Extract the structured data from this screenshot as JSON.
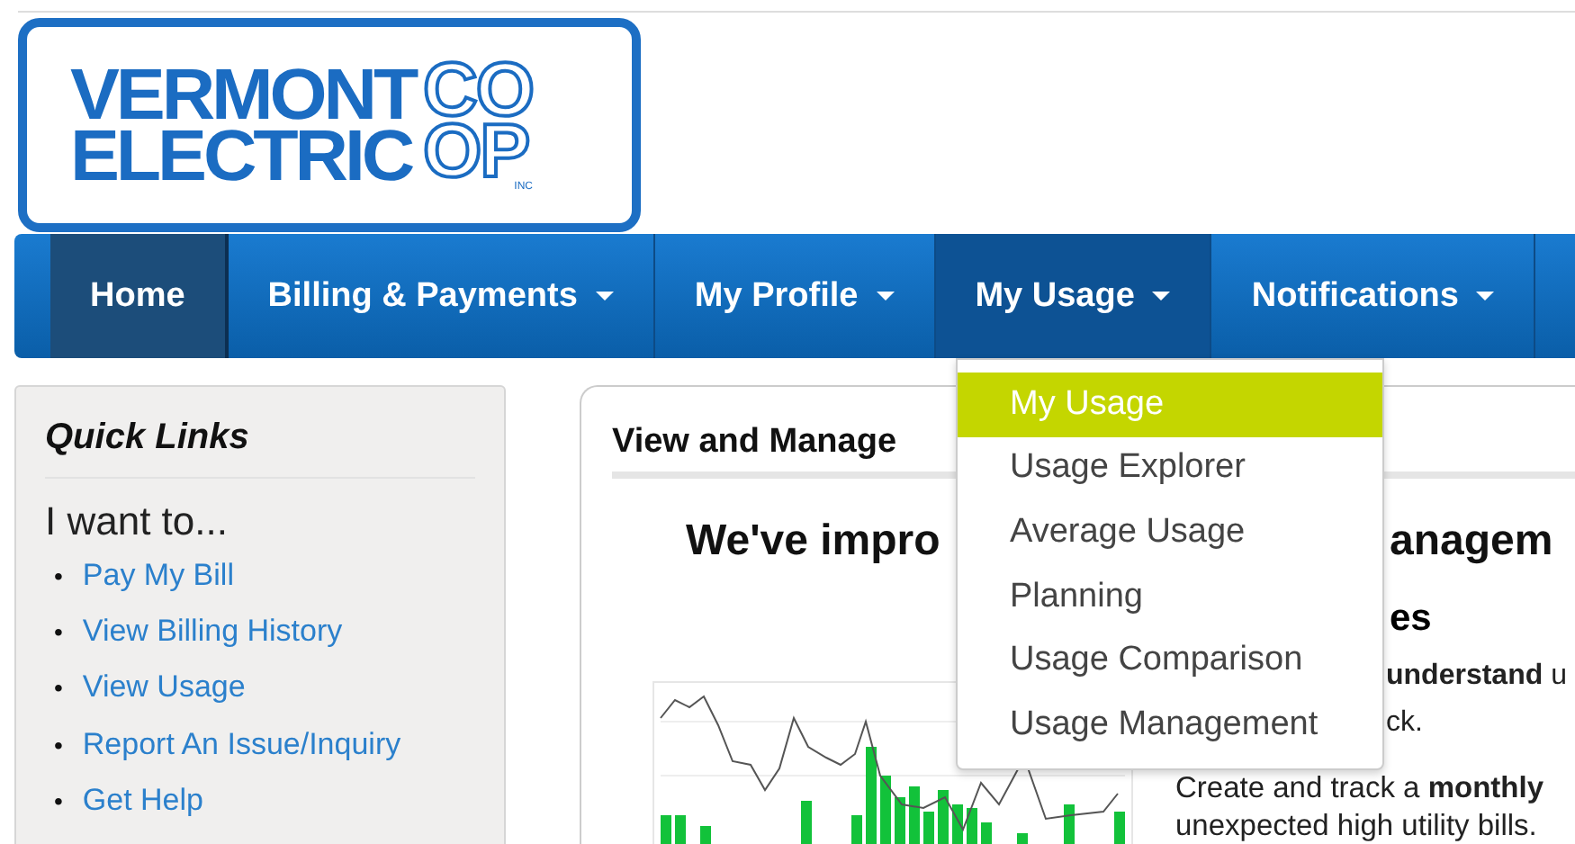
{
  "logo": {
    "line_1": "VERMONT",
    "line_2": "ELECTRIC",
    "mark_1": "CO",
    "mark_2": "OP",
    "mark_suffix": "INC"
  },
  "nav": [
    {
      "label": "Home",
      "selected": true,
      "has_menu": false,
      "open": false
    },
    {
      "label": "Billing & Payments",
      "selected": false,
      "has_menu": true,
      "open": false
    },
    {
      "label": "My Profile",
      "selected": false,
      "has_menu": true,
      "open": false
    },
    {
      "label": "My Usage",
      "selected": false,
      "has_menu": true,
      "open": true
    },
    {
      "label": "Notifications",
      "selected": false,
      "has_menu": true,
      "open": false
    }
  ],
  "usage_menu": [
    {
      "label": "My Usage",
      "selected": true
    },
    {
      "label": "Usage Explorer",
      "selected": false
    },
    {
      "label": "Average Usage",
      "selected": false
    },
    {
      "label": "Planning",
      "selected": false
    },
    {
      "label": "Usage Comparison",
      "selected": false
    },
    {
      "label": "Usage Management",
      "selected": false
    }
  ],
  "quick_links": {
    "title": "Quick Links",
    "intro": "I want to...",
    "bullet": "•",
    "links": [
      "Pay My Bill",
      "View Billing History",
      "View Usage",
      "Report An Issue/Inquiry",
      "Get Help"
    ]
  },
  "main": {
    "title": "View and Manage",
    "headline_left": "We've impro",
    "headline_right": "anagem",
    "subheading": "es",
    "feature_lines": [
      "**understand** u",
      "ck."
    ],
    "lower_lines": [
      "Create and track a **monthly**",
      "unexpected high utility bills."
    ]
  }
}
